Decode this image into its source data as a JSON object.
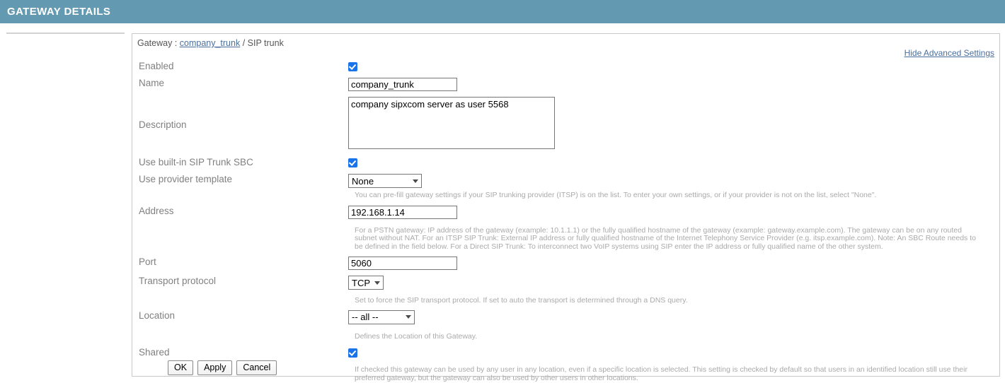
{
  "banner": {
    "title": "GATEWAY DETAILS"
  },
  "panel": {
    "breadcrumb": {
      "prefix": "Gateway : ",
      "link": "company_trunk",
      "suffix": " / SIP trunk"
    },
    "advanced_link": "Hide Advanced Settings"
  },
  "fields": {
    "enabled": {
      "label": "Enabled",
      "checked": true
    },
    "name": {
      "label": "Name",
      "value": "company_trunk"
    },
    "description": {
      "label": "Description",
      "value": "company sipxcom server as user 5568"
    },
    "sbc": {
      "label": "Use built-in SIP Trunk SBC",
      "checked": true
    },
    "provider_template": {
      "label": "Use provider template",
      "value": "None",
      "options": [
        "None"
      ],
      "help": "You can pre-fill gateway settings if your SIP trunking provider (ITSP) is on the list. To enter your own settings, or if your provider is not on the list, select \"None\"."
    },
    "address": {
      "label": "Address",
      "value": "192.168.1.14",
      "help": "For a PSTN gateway: IP address of the gateway (example: 10.1.1.1) or the fully qualified hostname of the gateway (example: gateway.example.com). The gateway can be on any routed subnet without NAT. For an ITSP SIP Trunk: External IP address or fully qualified hostname of the Internet Telephony Service Provider (e.g. itsp.example.com). Note: An SBC Route needs to be defined in the field below. For a Direct SIP Trunk: To interconnect two VoIP systems using SIP enter the IP address or fully qualified name of the other system."
    },
    "port": {
      "label": "Port",
      "value": "5060"
    },
    "transport_protocol": {
      "label": "Transport protocol",
      "value": "TCP",
      "options": [
        "TCP"
      ],
      "help": "Set to force the SIP transport protocol. If set to auto the transport is determined through a DNS query."
    },
    "location": {
      "label": "Location",
      "value": "-- all --",
      "options": [
        "-- all --"
      ],
      "help": "Defines the Location of this Gateway."
    },
    "shared": {
      "label": "Shared",
      "checked": true,
      "help": "If checked this gateway can be used by any user in any location, even if a specific location is selected. This setting is checked by default so that users in an identified location still use their preferred gateway, but the gateway can also be used by other users in other locations."
    }
  },
  "buttons": {
    "ok": "OK",
    "apply": "Apply",
    "cancel": "Cancel"
  },
  "colors": {
    "banner": "#649ab1",
    "checkbox": "#1a73e8",
    "link": "#4a6f9c",
    "label": "#808080",
    "help": "#aaaaaa"
  }
}
